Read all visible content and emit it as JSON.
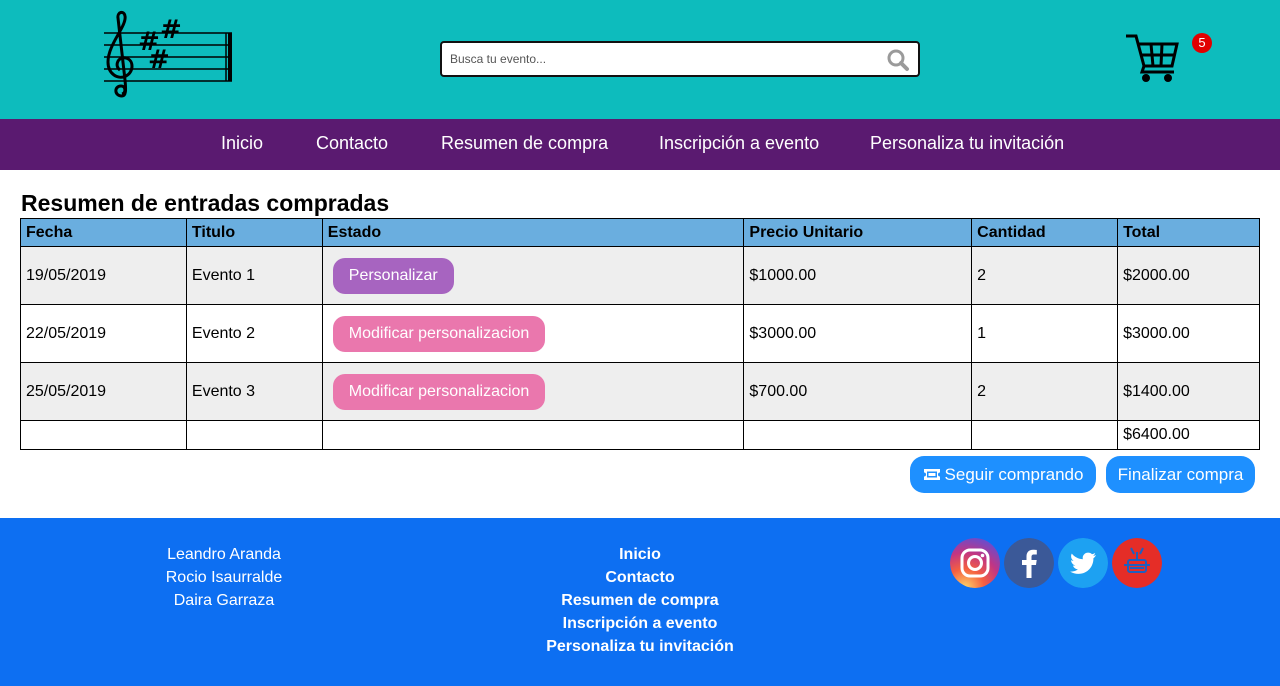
{
  "header": {
    "search_placeholder": "Busca tu evento...",
    "cart_count": "5",
    "accent_color": "#0dbcbd"
  },
  "nav": {
    "items": [
      {
        "label": "Inicio"
      },
      {
        "label": "Contacto"
      },
      {
        "label": "Resumen de compra"
      },
      {
        "label": "Inscripción a evento"
      },
      {
        "label": "Personaliza tu invitación"
      }
    ],
    "color": "#5a1a70"
  },
  "main": {
    "title": "Resumen de entradas compradas",
    "columns": [
      "Fecha",
      "Titulo",
      "Estado",
      "Precio Unitario",
      "Cantidad",
      "Total"
    ],
    "rows": [
      {
        "fecha": "19/05/2019",
        "titulo": "Evento 1",
        "estado": "Personalizar",
        "precio": "$1000.00",
        "cantidad": "2",
        "total": "$2000.00"
      },
      {
        "fecha": "22/05/2019",
        "titulo": "Evento 2",
        "estado": "Modificar personalizacion",
        "precio": "$3000.00",
        "cantidad": "1",
        "total": "$3000.00"
      },
      {
        "fecha": "25/05/2019",
        "titulo": "Evento 3",
        "estado": "Modificar personalizacion",
        "precio": "$700.00",
        "cantidad": "2",
        "total": "$1400.00"
      }
    ],
    "grand_total": "$6400.00",
    "continue_label": "Seguir comprando",
    "finish_label": "Finalizar compra"
  },
  "footer": {
    "names": [
      "Leandro Aranda",
      "Rocio Isaurralde",
      "Daira Garraza"
    ],
    "links": [
      "Inicio",
      "Contacto",
      "Resumen de compra",
      "Inscripción a evento",
      "Personaliza tu invitación"
    ],
    "social": [
      "instagram-icon",
      "facebook-icon",
      "twitter-icon",
      "youtube-icon"
    ],
    "color": "#0d6ff2"
  }
}
